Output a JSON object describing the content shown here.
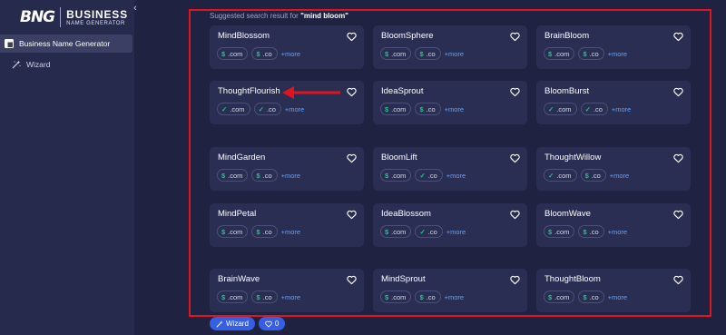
{
  "brand": {
    "mark": "BNG",
    "title": "BUSINESS",
    "subtitle": "NAME GENERATOR"
  },
  "sidebar": {
    "collapse_icon": "‹",
    "items": [
      {
        "label": "Business Name Generator",
        "icon": "layout-icon",
        "active": true
      },
      {
        "label": "Wizard",
        "icon": "wand-icon",
        "active": false
      }
    ]
  },
  "search": {
    "prefix": "Suggested search result for ",
    "query": "\"mind bloom\""
  },
  "more_label": "+more",
  "results": [
    {
      "name": "MindBlossom",
      "com": "unknown",
      "co": "unknown"
    },
    {
      "name": "BloomSphere",
      "com": "unknown",
      "co": "unknown"
    },
    {
      "name": "BrainBloom",
      "com": "unknown",
      "co": "unknown"
    },
    {
      "name": "ThoughtFlourish",
      "com": "available",
      "co": "available"
    },
    {
      "name": "IdeaSprout",
      "com": "unknown",
      "co": "unknown"
    },
    {
      "name": "BloomBurst",
      "com": "available",
      "co": "available"
    },
    {
      "name": "MindGarden",
      "com": "unknown",
      "co": "unknown"
    },
    {
      "name": "BloomLift",
      "com": "unknown",
      "co": "available"
    },
    {
      "name": "ThoughtWillow",
      "com": "available",
      "co": "unknown"
    },
    {
      "name": "MindPetal",
      "com": "unknown",
      "co": "unknown"
    },
    {
      "name": "IdeaBlossom",
      "com": "unknown",
      "co": "available"
    },
    {
      "name": "BloomWave",
      "com": "unknown",
      "co": "unknown"
    },
    {
      "name": "BrainWave",
      "com": "unknown",
      "co": "unknown"
    },
    {
      "name": "MindSprout",
      "com": "unknown",
      "co": "unknown"
    },
    {
      "name": "ThoughtBloom",
      "com": "unknown",
      "co": "unknown"
    }
  ],
  "tld_labels": {
    "com": ".com",
    "co": ".co"
  },
  "bottom": {
    "wizard_label": "Wizard",
    "favorites_count": "0"
  },
  "colors": {
    "background": "#1f2240",
    "card": "#2a2e52",
    "accent": "#3560e6",
    "highlight_frame": "#e0141e",
    "status_green": "#26c28a"
  }
}
